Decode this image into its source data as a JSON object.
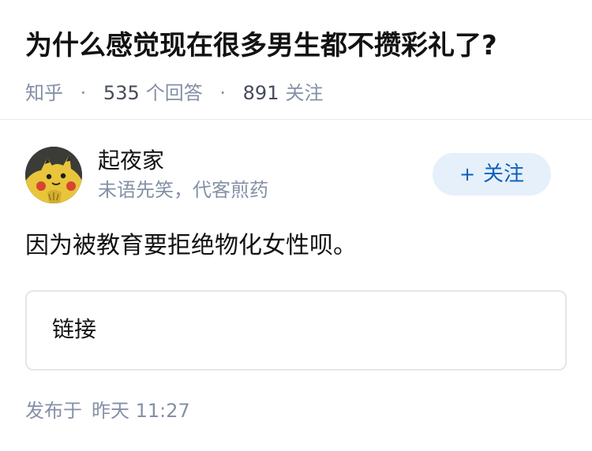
{
  "question": {
    "title": "为什么感觉现在很多男生都不攒彩礼了?",
    "source": "知乎",
    "answer_count": "535",
    "answer_label": "个回答",
    "follow_count": "891",
    "follow_label": "关注"
  },
  "author": {
    "name": "起夜家",
    "bio": "未语先笑，代客煎药",
    "avatar_icon": "pikachu-avatar"
  },
  "follow_button": {
    "plus": "+",
    "label": "关注"
  },
  "answer": {
    "text": "因为被教育要拒绝物化女性呗。"
  },
  "link_card": {
    "label": "链接"
  },
  "publish": {
    "label": "发布于",
    "time": "昨天 11:27"
  },
  "colors": {
    "title": "#121212",
    "meta": "#8590a6",
    "accent": "#0a60bd",
    "button_bg": "#e6f0fa",
    "border": "#e6e6e6"
  }
}
